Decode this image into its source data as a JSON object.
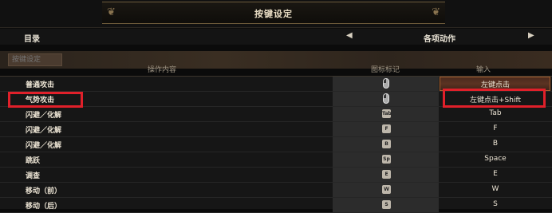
{
  "window": {
    "title": "按键设定"
  },
  "nav": {
    "left_label": "目录",
    "category": "各项动作",
    "prev_arrow": "◀",
    "next_arrow": "▶"
  },
  "search": {
    "placeholder": "按键设定"
  },
  "columns": {
    "action": "操作内容",
    "icon": "图标标记",
    "input": "输入"
  },
  "rows": [
    {
      "action": "普通攻击",
      "icon": "mouse-left-icon",
      "key": "左键点击"
    },
    {
      "action": "气势攻击",
      "icon": "mouse-left-shift-icon",
      "key": "左键点击+Shift"
    },
    {
      "action": "闪避／化解",
      "icon": "Tab",
      "key": "Tab"
    },
    {
      "action": "闪避／化解",
      "icon": "F",
      "key": "F"
    },
    {
      "action": "闪避／化解",
      "icon": "B",
      "key": "B"
    },
    {
      "action": "跳跃",
      "icon": "Sp",
      "key": "Space"
    },
    {
      "action": "调查",
      "icon": "E",
      "key": "E"
    },
    {
      "action": "移动（前）",
      "icon": "W",
      "key": "W"
    },
    {
      "action": "移动（后）",
      "icon": "S",
      "key": "S"
    }
  ],
  "colors": {
    "annotation": "#e0202a",
    "selected_row": "#5b3322"
  }
}
